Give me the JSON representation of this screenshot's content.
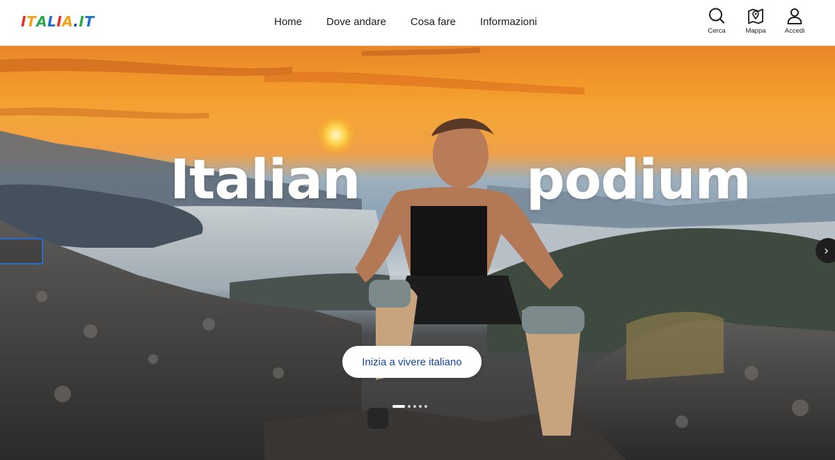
{
  "brand": {
    "logo_text": "ITALIA.IT",
    "logo_letters": [
      "I",
      "T",
      "A",
      "L",
      "I",
      "A",
      ".",
      "I",
      "T"
    ],
    "logo_colors": [
      "#e4322b",
      "#f3a21a",
      "#2aa84a",
      "#1f6fd1",
      "#e4322b",
      "#f3a21a",
      "#1f3f8f",
      "#2aa84a",
      "#1f6fd1"
    ]
  },
  "nav": {
    "items": [
      {
        "label": "Home"
      },
      {
        "label": "Dove andare"
      },
      {
        "label": "Cosa fare"
      },
      {
        "label": "Informazioni"
      }
    ]
  },
  "tools": {
    "search_label": "Cerca",
    "map_label": "Mappa",
    "login_label": "Accedi",
    "icons": [
      "search-icon",
      "map-pin-icon",
      "user-icon"
    ]
  },
  "hero": {
    "headline_word_1": "Italian",
    "headline_word_2": "podium",
    "cta_label": "Inizia a vivere italiano",
    "next_icon": "chevron-right-icon",
    "carousel_total": 5,
    "carousel_active": 1
  },
  "colors": {
    "cta_text": "#1746a2",
    "side_tab_border": "#2b6bcf"
  }
}
